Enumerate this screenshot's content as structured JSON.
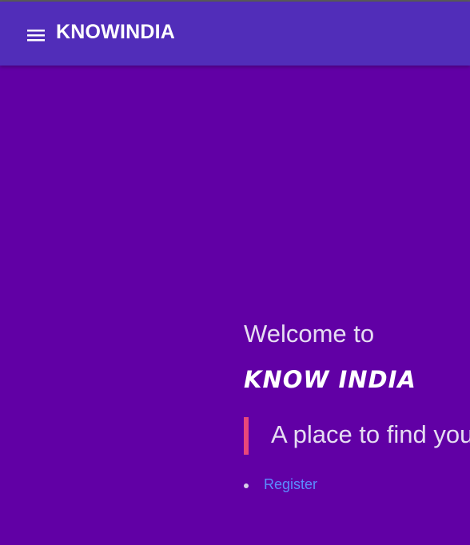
{
  "header": {
    "brand": "KNOWINDIA",
    "menu_icon": "hamburger-menu-icon"
  },
  "hero": {
    "welcome": "Welcome to",
    "title": "Know India",
    "tagline": "A place to find you"
  },
  "links": {
    "items": [
      {
        "label": "Register"
      }
    ]
  },
  "colors": {
    "background": "#6100a5",
    "app_bar": "#512db9",
    "accent_bar": "#e8477a",
    "link": "#5b8cff"
  }
}
